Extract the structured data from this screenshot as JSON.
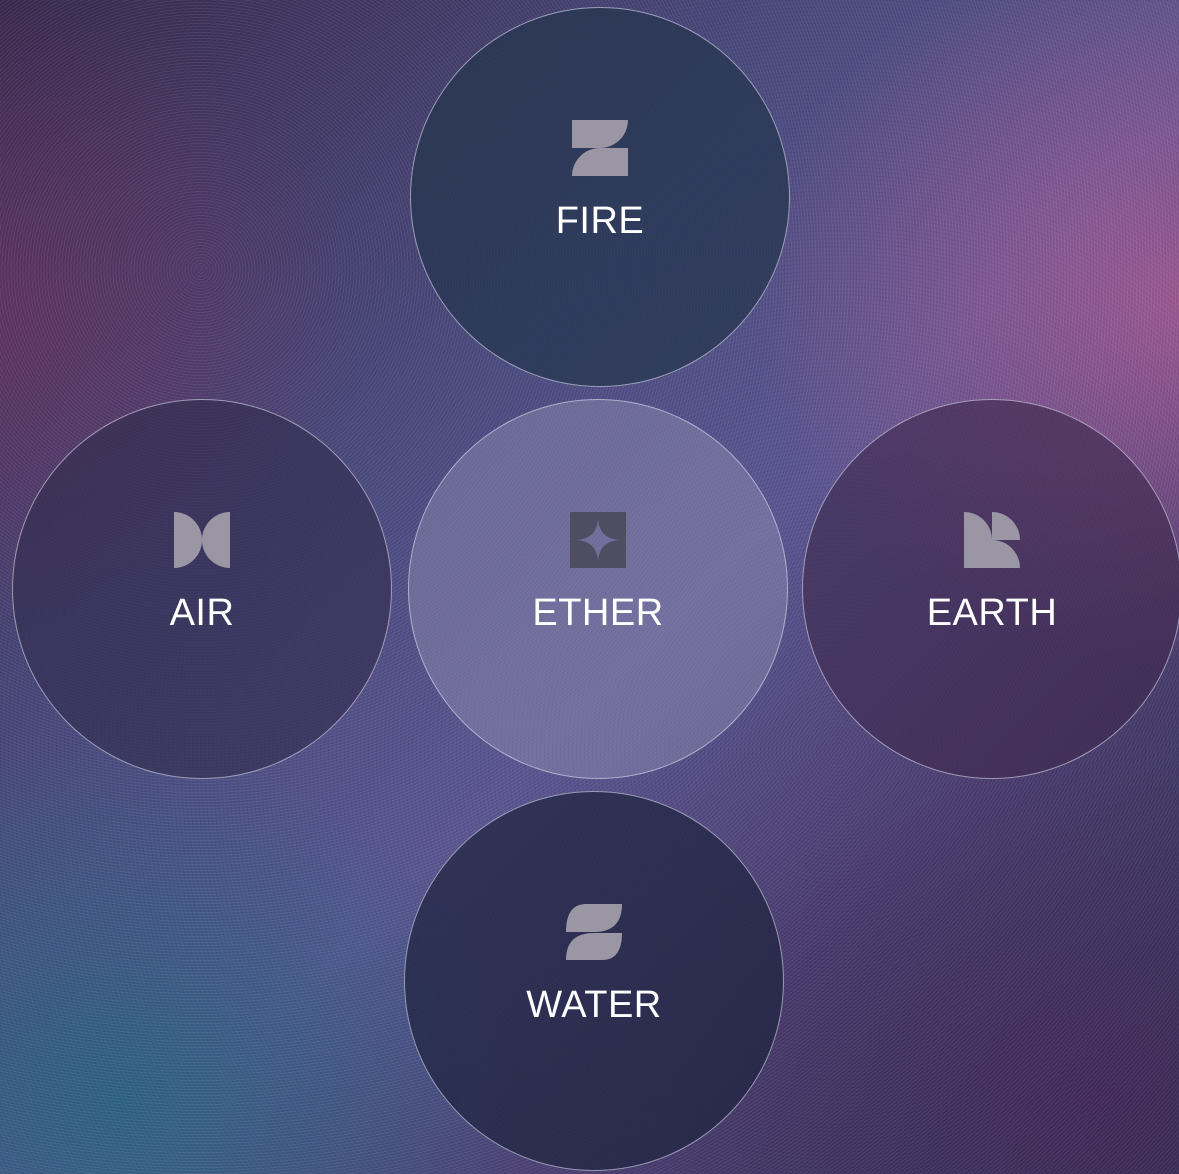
{
  "elements": {
    "fire": {
      "label": "FIRE",
      "icon": "fire-icon"
    },
    "air": {
      "label": "AIR",
      "icon": "air-icon"
    },
    "ether": {
      "label": "ETHER",
      "icon": "ether-icon"
    },
    "earth": {
      "label": "EARTH",
      "icon": "earth-icon"
    },
    "water": {
      "label": "WATER",
      "icon": "water-icon"
    }
  },
  "colors": {
    "icon": "#9a96a4",
    "ether_icon": "#4e4d62",
    "border": "#d2d2e6",
    "label": "#ffffff"
  }
}
